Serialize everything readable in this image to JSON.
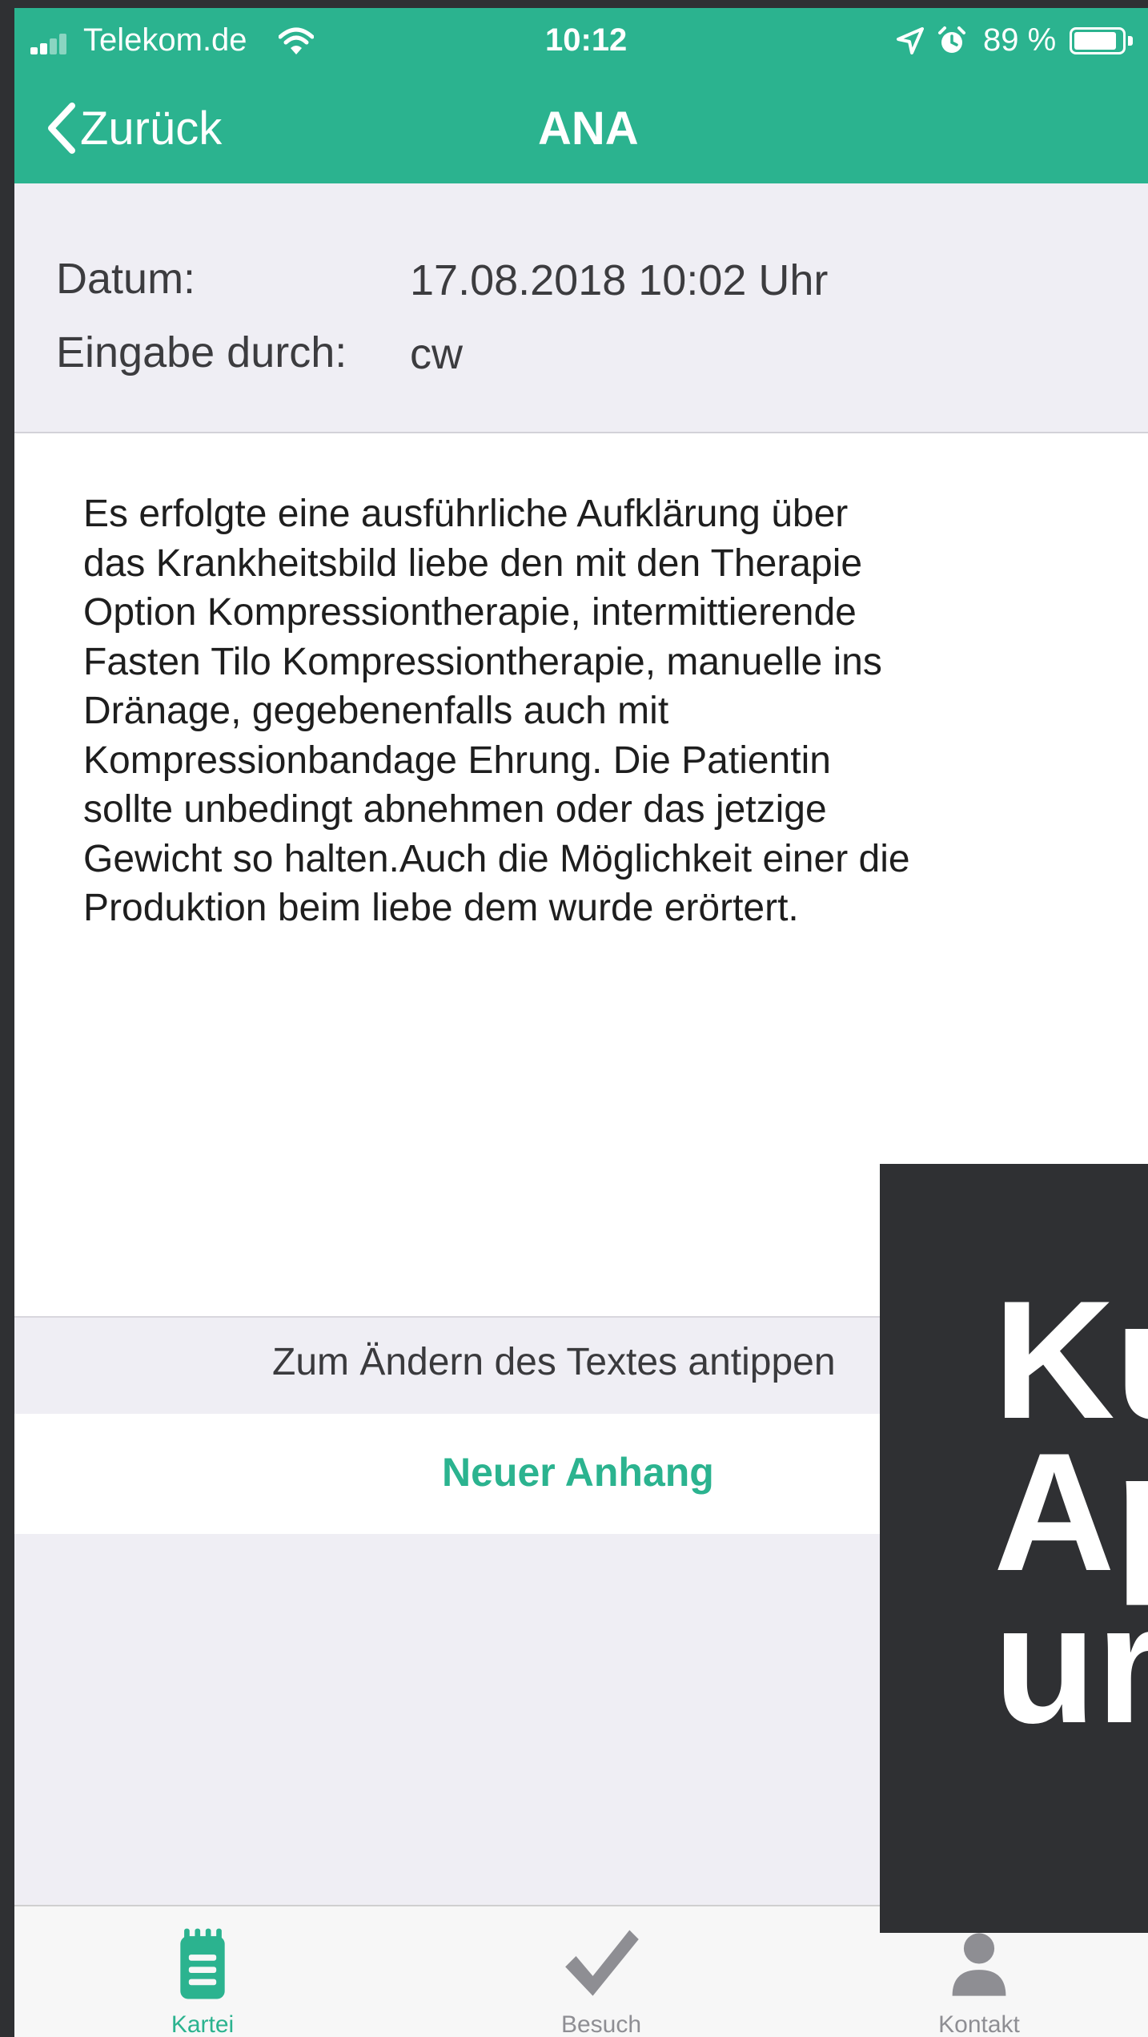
{
  "status_bar": {
    "carrier": "Telekom.de",
    "time": "10:12",
    "battery": "89 %",
    "battery_level": 0.89
  },
  "nav": {
    "back_label": "Zurück",
    "title": "ANA"
  },
  "meta": {
    "date_label": "Datum:",
    "date_value": "17.08.2018 10:02 Uhr",
    "author_label": "Eingabe durch:",
    "author_value": "cw"
  },
  "note": {
    "text": "Es erfolgte eine ausführliche Aufklärung über\ndas Krankheitsbild liebe den mit den Therapie\nOption Kompressiontherapie, intermittierende\nFasten Tilo Kompressiontherapie, manuelle ins\nDränage, gegebenenfalls auch mit\nKompressionbandage Ehrung. Die Patientin\nsollte unbedingt abnehmen oder das jetzige\nGewicht so halten.Auch die Möglichkeit einer die\nProduktion beim liebe dem wurde erörtert."
  },
  "edit_hint": "Zum Ändern des Textes antippen",
  "attachment_button": "Neuer Anhang",
  "tabs": [
    {
      "label": "Kartei",
      "icon": "notepad-icon",
      "active": true
    },
    {
      "label": "Besuch",
      "icon": "checkmark-icon",
      "active": false
    },
    {
      "label": "Kontakt",
      "icon": "person-icon",
      "active": false
    }
  ],
  "overlay": {
    "text": "Ku\nAp\nur"
  },
  "colors": {
    "accent": "#2bb38f",
    "background": "#efeef4",
    "overlay": "#2f3033",
    "tab_inactive": "#8e8e93"
  }
}
